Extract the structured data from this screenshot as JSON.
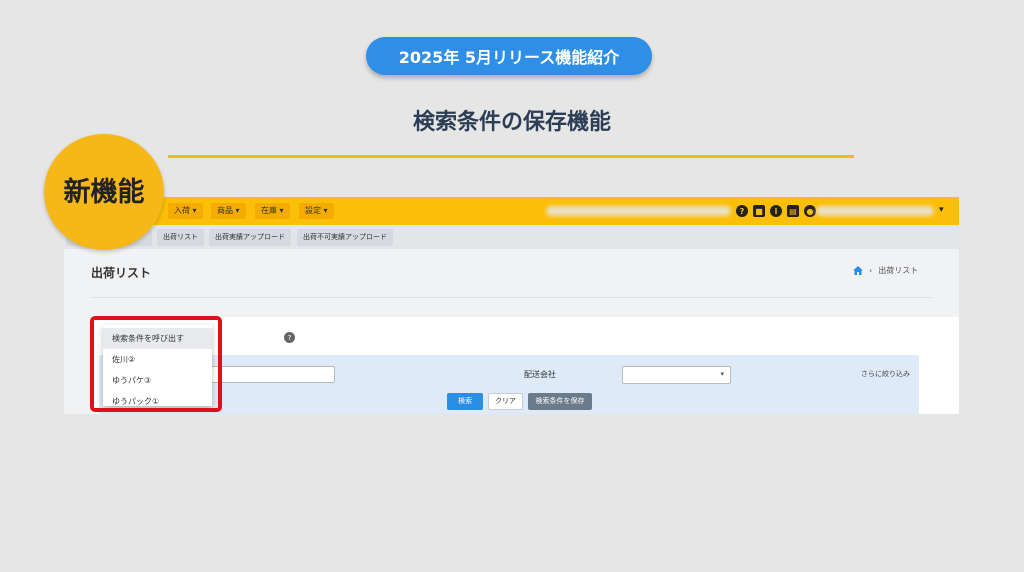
{
  "slide": {
    "pill_text": "2025年 5月リリース機能紹介",
    "headline": "検索条件の保存機能",
    "badge_text": "新機能"
  },
  "nav": {
    "items": [
      "入荷 ▾",
      "商品 ▾",
      "在庫 ▾",
      "設定 ▾"
    ],
    "caret": "▾"
  },
  "subnav": {
    "items": [
      "出荷リスト",
      "出荷実績アップロード",
      "出荷不可実績アップロード"
    ]
  },
  "page": {
    "title": "出荷リスト",
    "breadcrumb_separator": "›",
    "breadcrumb_current": "出荷リスト"
  },
  "filter": {
    "help": "?",
    "carrier_label": "配送会社",
    "more_label": "さらに絞り込み",
    "select_caret": "▾",
    "search_button": "検索",
    "clear_button": "クリア",
    "save_button": "検索条件を保存"
  },
  "saved_conditions": {
    "items": [
      "検索条件を呼び出す",
      "佐川②",
      "ゆうパケ③",
      "ゆうパック①"
    ]
  },
  "colors": {
    "accent_blue": "#2f8ee6",
    "nav_yellow": "#fcbf07",
    "highlight_red": "#e0101a"
  }
}
